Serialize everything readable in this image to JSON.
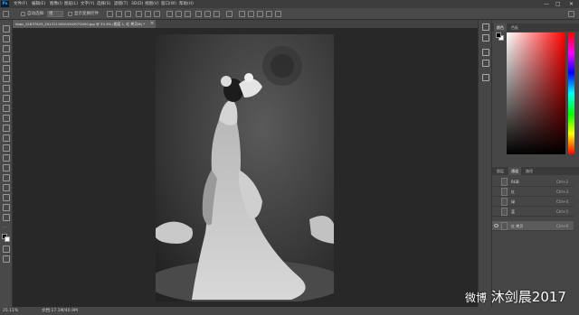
{
  "app": {
    "logo": "Ps"
  },
  "menu": [
    "文件(F)",
    "编辑(E)",
    "图像(I)",
    "图层(L)",
    "文字(Y)",
    "选择(S)",
    "滤镜(T)",
    "3D(D)",
    "视图(V)",
    "窗口(W)",
    "帮助(H)"
  ],
  "window_controls": {
    "minimize": "—",
    "maximize": "□",
    "close": "✕"
  },
  "options_bar": {
    "auto_select_label": "自动选择:",
    "auto_select_value": "组",
    "show_transform_label": "显示变换控件"
  },
  "document_tab": {
    "title": "hbpc_51837625_20131118104345072000.jpg @ 33.3% (图层 1, 红 拷贝/8) *",
    "close": "×"
  },
  "status_bar": {
    "zoom": "25.11%",
    "doc_info": "文档:17.1M/40.9M"
  },
  "panels": {
    "color_tabs": [
      "颜色",
      "色板"
    ],
    "channel_tabs": [
      "图层",
      "通道",
      "路径"
    ],
    "active_channel_tab": "通道",
    "channels": [
      {
        "name": "RGB",
        "shortcut": "Ctrl+2",
        "visible": false,
        "selected": false
      },
      {
        "name": "红",
        "shortcut": "Ctrl+3",
        "visible": false,
        "selected": false
      },
      {
        "name": "绿",
        "shortcut": "Ctrl+4",
        "visible": false,
        "selected": false
      },
      {
        "name": "蓝",
        "shortcut": "Ctrl+5",
        "visible": false,
        "selected": false
      },
      {
        "name": "红 拷贝",
        "shortcut": "Ctrl+6",
        "visible": true,
        "selected": true
      }
    ]
  },
  "watermark": {
    "text": "沐剑晨2017",
    "logo": "微博"
  },
  "colors": {
    "accent": "#31a8ff",
    "panel": "#464646",
    "canvas_bg": "#282828"
  }
}
